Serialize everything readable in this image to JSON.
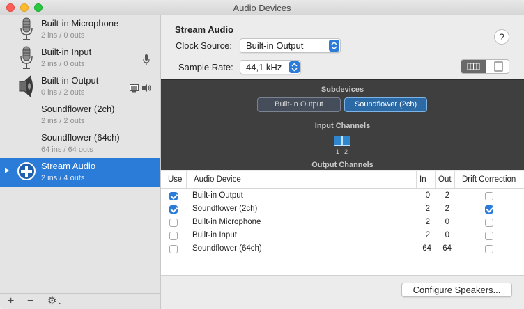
{
  "window": {
    "title": "Audio Devices"
  },
  "sidebar": {
    "devices": [
      {
        "name": "Built-in Microphone",
        "io": "2 ins / 0 outs",
        "icon": "microphone-icon"
      },
      {
        "name": "Built-in Input",
        "io": "2 ins / 0 outs",
        "icon": "microphone-icon",
        "badge": "mic-input-icon"
      },
      {
        "name": "Built-in Output",
        "io": "0 ins / 2 outs",
        "icon": "speaker-icon",
        "badge": "system-output-icon"
      },
      {
        "name": "Soundflower (2ch)",
        "io": "2 ins / 2 outs"
      },
      {
        "name": "Soundflower (64ch)",
        "io": "64 ins / 64 outs"
      },
      {
        "name": "Stream Audio",
        "io": "2 ins / 4 outs",
        "icon": "aggregate-device-icon",
        "selected": true
      }
    ],
    "add_label": "+",
    "remove_label": "−",
    "gear_label": "⚙",
    "gear_caret": "⌄"
  },
  "main": {
    "title": "Stream Audio",
    "clock_source_label": "Clock Source:",
    "clock_source_value": "Built-in Output",
    "sample_rate_label": "Sample Rate:",
    "sample_rate_value": "44,1 kHz",
    "help_label": "?",
    "subdevices_label": "Subdevices",
    "subdevices": [
      "Built-in Output",
      "Soundflower (2ch)"
    ],
    "input_channels_label": "Input Channels",
    "input_channels": [
      "1",
      "2"
    ],
    "output_channels_label": "Output Channels",
    "table": {
      "headers": {
        "use": "Use",
        "device": "Audio Device",
        "in": "In",
        "out": "Out",
        "drift": "Drift Correction"
      },
      "rows": [
        {
          "use": true,
          "device": "Built-in Output",
          "in": "0",
          "out": "2",
          "drift": false
        },
        {
          "use": true,
          "device": "Soundflower (2ch)",
          "in": "2",
          "out": "2",
          "drift": true
        },
        {
          "use": false,
          "device": "Built-in Microphone",
          "in": "2",
          "out": "0",
          "drift": false
        },
        {
          "use": false,
          "device": "Built-in Input",
          "in": "2",
          "out": "0",
          "drift": false
        },
        {
          "use": false,
          "device": "Soundflower (64ch)",
          "in": "64",
          "out": "64",
          "drift": false
        }
      ]
    },
    "configure_button": "Configure Speakers..."
  },
  "colors": {
    "accent": "#2b7bd9",
    "dark_panel": "#3f3f3f"
  }
}
